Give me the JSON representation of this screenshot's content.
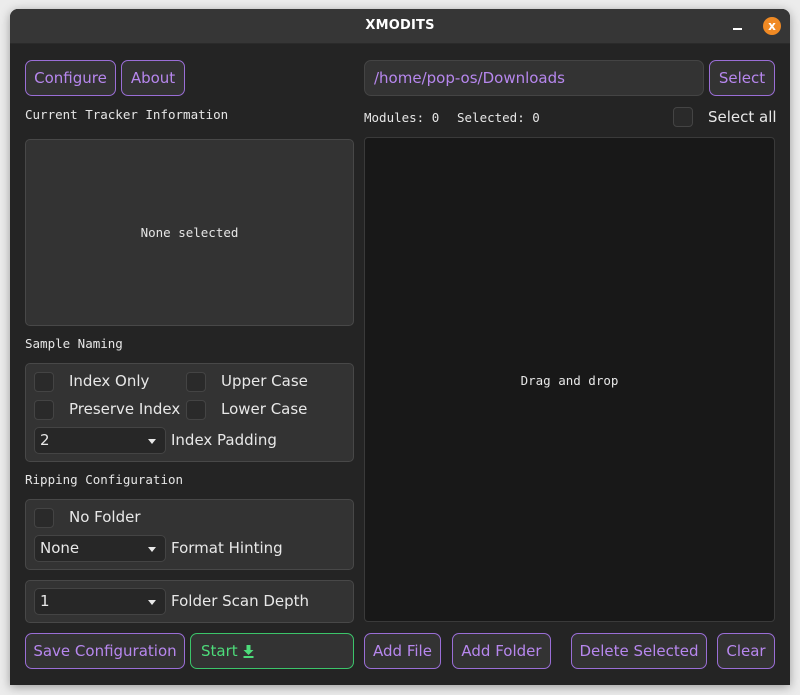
{
  "window": {
    "title": "XMODITS",
    "minimize_icon": "minimize-icon",
    "close_icon": "close-icon",
    "close_glyph": "x"
  },
  "left": {
    "configure_label": "Configure",
    "about_label": "About",
    "tracker_info_heading": "Current Tracker Information",
    "tracker_info_text": "None selected",
    "sample_naming_heading": "Sample Naming",
    "sample_naming": {
      "index_only": {
        "label": "Index Only",
        "checked": false
      },
      "upper_case": {
        "label": "Upper Case",
        "checked": false
      },
      "preserve_index": {
        "label": "Preserve Index",
        "checked": false
      },
      "lower_case": {
        "label": "Lower Case",
        "checked": false
      },
      "index_padding": {
        "value": "2",
        "label": "Index Padding"
      }
    },
    "ripping_heading": "Ripping Configuration",
    "ripping": {
      "no_folder": {
        "label": "No Folder",
        "checked": false
      },
      "format_hinting": {
        "value": "None",
        "label": "Format Hinting"
      }
    },
    "scan_depth": {
      "value": "1",
      "label": "Folder Scan Depth"
    },
    "save_label": "Save Configuration",
    "start_label": "Start",
    "start_icon": "download-icon"
  },
  "right": {
    "path_value": "/home/pop-os/Downloads",
    "select_label": "Select",
    "modules_text": "Modules: 0",
    "selected_text": "Selected: 0",
    "select_all": {
      "label": "Select all",
      "checked": false
    },
    "dropzone_text": "Drag and drop",
    "add_file_label": "Add File",
    "add_folder_label": "Add Folder",
    "delete_selected_label": "Delete Selected",
    "clear_label": "Clear"
  },
  "colors": {
    "accent": "#b787ee",
    "start": "#4ddb7a",
    "close": "#f08a24",
    "background": "#242424"
  }
}
